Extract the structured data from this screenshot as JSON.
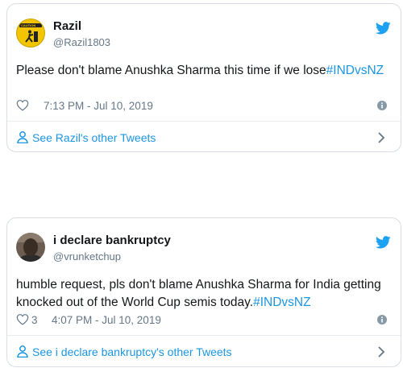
{
  "tweets": [
    {
      "name": "Razil",
      "handle": "@Razil1803",
      "text_before": "Please don't blame Anushka Sharma this time if we lose",
      "hashtag": "#INDvsNZ",
      "likes": "",
      "timestamp": "7:13 PM - Jul 10, 2019",
      "see_more": "See Razil's other Tweets",
      "avatar": "caution-sign-avatar",
      "avatar_text": "CAUTION"
    },
    {
      "name": "i declare bankruptcy",
      "handle": "@vrunketchup",
      "text_before": "humble request, pls don't blame Anushka Sharma for India getting knocked out of the World Cup semis today.",
      "hashtag": "#INDvsNZ",
      "likes": "3",
      "timestamp": "4:07 PM - Jul 10, 2019",
      "see_more": "See i declare bankruptcy's other Tweets",
      "avatar": "person-photo-avatar"
    }
  ],
  "colors": {
    "link": "#1b95e0",
    "text": "#14171a",
    "muted": "#657786",
    "border": "#d8dee3"
  },
  "icons": [
    "twitter-bird-icon",
    "heart-icon",
    "info-icon",
    "user-icon",
    "chevron-right-icon"
  ]
}
